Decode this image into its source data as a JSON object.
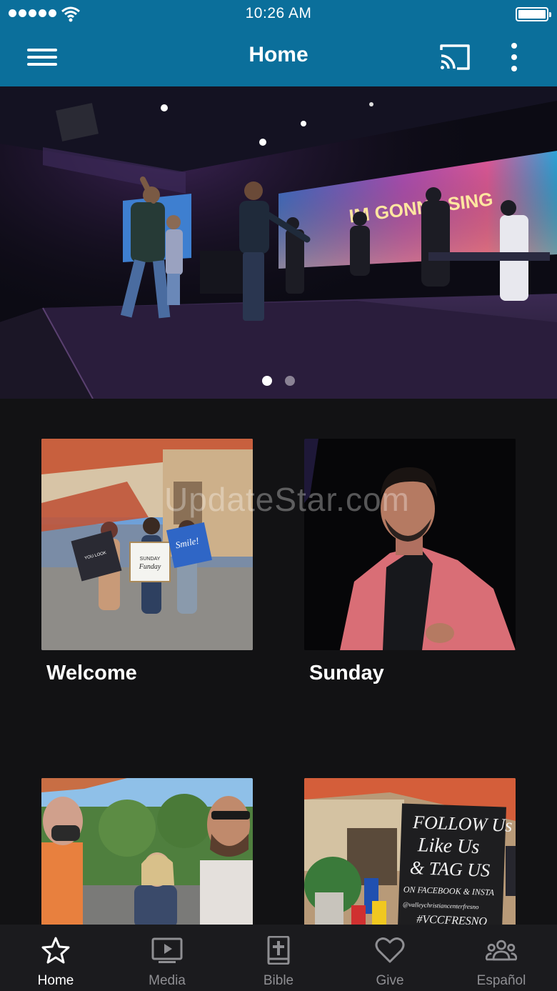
{
  "status_bar": {
    "time": "10:26 AM"
  },
  "app_bar": {
    "title": "Home"
  },
  "hero": {
    "screen_text": "IM GONNA SING",
    "slides": 2,
    "active_slide": 1
  },
  "watermark": "UpdateStar.com",
  "tiles": [
    {
      "label": "Welcome"
    },
    {
      "label": "Sunday"
    },
    {
      "label": ""
    },
    {
      "label": ""
    }
  ],
  "photo_text": {
    "welcome_signs": [
      "YOU LOOK AMAZING TODAY!",
      "SUNDAY Funday",
      "Smile!"
    ],
    "chalkboard": [
      "FOLLOW Us",
      "Like Us",
      "& TAG US",
      "ON FACEBOOK & INSTA",
      "@valleychristiancenterfresno",
      "#VCCFRESNO"
    ]
  },
  "bottom_nav": [
    {
      "label": "Home",
      "icon": "star-icon",
      "active": true
    },
    {
      "label": "Media",
      "icon": "tv-play-icon",
      "active": false
    },
    {
      "label": "Bible",
      "icon": "bible-icon",
      "active": false
    },
    {
      "label": "Give",
      "icon": "heart-icon",
      "active": false
    },
    {
      "label": "Español",
      "icon": "group-icon",
      "active": false
    }
  ],
  "colors": {
    "header": "#0b6f9b",
    "background": "#121214",
    "nav_background": "#1b1b1e",
    "nav_inactive": "#8f8f93"
  }
}
